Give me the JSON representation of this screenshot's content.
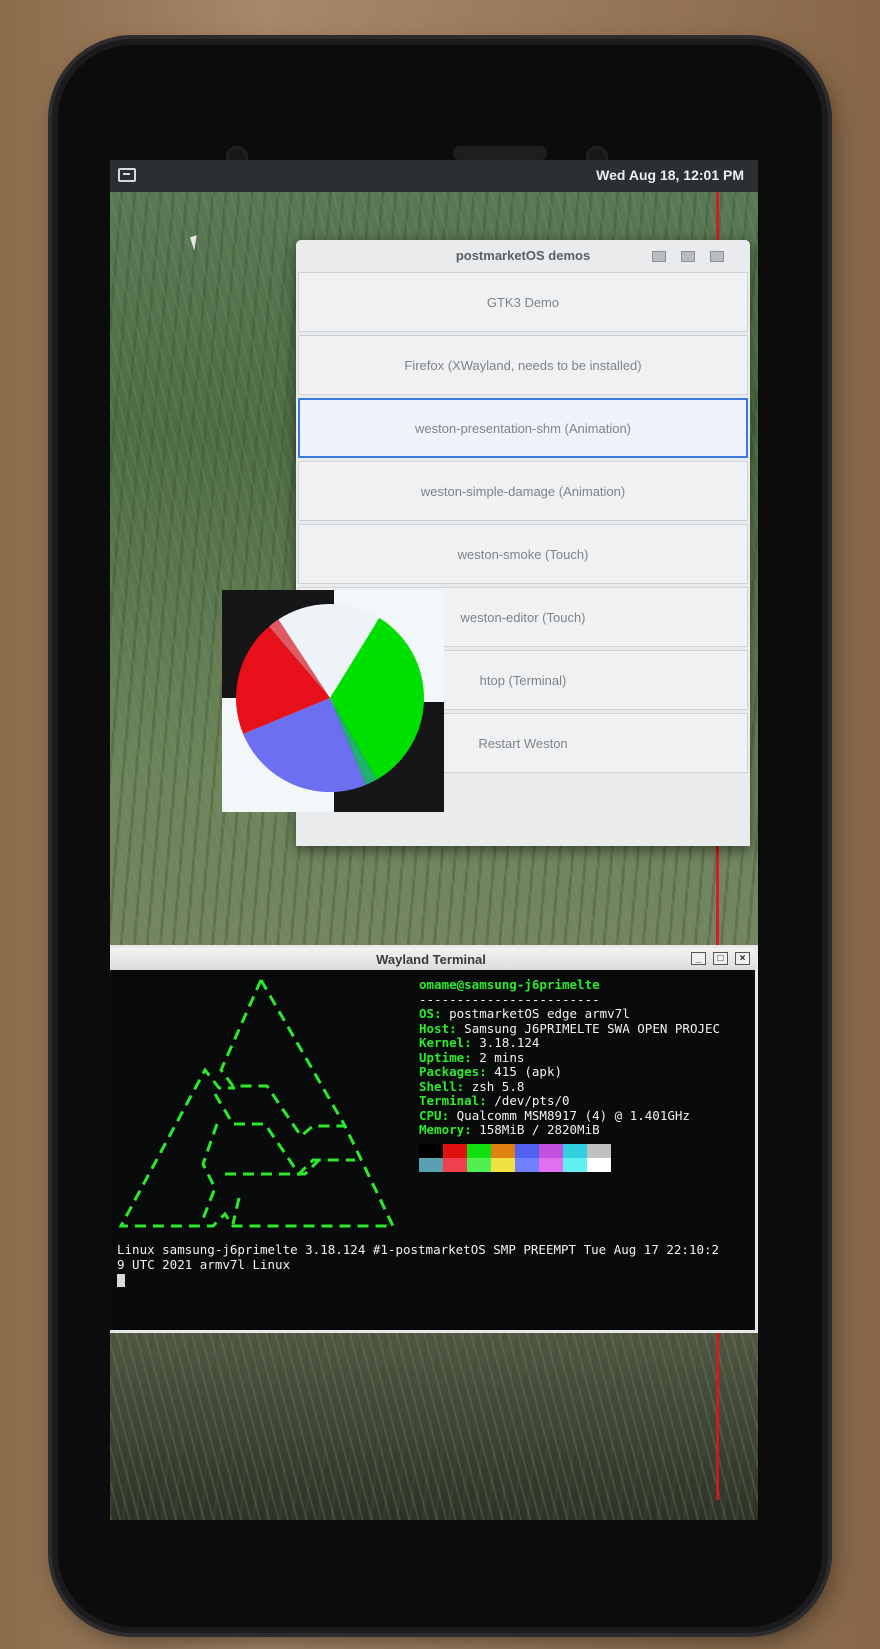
{
  "topbar": {
    "clock": "Wed Aug 18, 12:01 PM",
    "left_icon": "terminal-icon"
  },
  "demos_window": {
    "title": "postmarketOS demos",
    "buttons": [
      {
        "label": "GTK3 Demo"
      },
      {
        "label": "Firefox (XWayland, needs to be installed)"
      },
      {
        "label": "weston-presentation-shm (Animation)",
        "focused": true
      },
      {
        "label": "weston-simple-damage (Animation)"
      },
      {
        "label": "weston-smoke (Touch)"
      },
      {
        "label": "weston-editor (Touch)"
      },
      {
        "label": "htop (Terminal)"
      },
      {
        "label": "Restart Weston"
      }
    ]
  },
  "pie_demo": {
    "slices": [
      {
        "color": "#00e000",
        "value": 0.33
      },
      {
        "color": "#20b070",
        "value": 0.02
      },
      {
        "color": "#6b6ff0",
        "value": 0.25
      },
      {
        "color": "#e8101a",
        "value": 0.2
      },
      {
        "color": "#e05a63",
        "value": 0.02
      },
      {
        "color": "#eef3f8",
        "value": 0.18
      }
    ]
  },
  "terminal": {
    "title": "Wayland Terminal",
    "user": "omame@samsung-j6primelte",
    "separator": "------------------------",
    "fields": [
      {
        "key": "OS",
        "value": "postmarketOS edge armv7l"
      },
      {
        "key": "Host",
        "value": "Samsung J6PRIMELTE SWA OPEN PROJEC"
      },
      {
        "key": "Kernel",
        "value": "3.18.124"
      },
      {
        "key": "Uptime",
        "value": "2 mins"
      },
      {
        "key": "Packages",
        "value": "415 (apk)"
      },
      {
        "key": "Shell",
        "value": "zsh 5.8"
      },
      {
        "key": "Terminal",
        "value": "/dev/pts/0"
      },
      {
        "key": "CPU",
        "value": "Qualcomm MSM8917 (4) @ 1.401GHz"
      },
      {
        "key": "Memory",
        "value": "158MiB / 2820MiB"
      }
    ],
    "palette_top": [
      "#000000",
      "#e01010",
      "#10e010",
      "#e08010",
      "#5060f0",
      "#c050e0",
      "#30d0e0",
      "#c0c0c0"
    ],
    "palette_bottom": [
      "#5aa0b0",
      "#f04050",
      "#50f050",
      "#f0e040",
      "#7080ff",
      "#e070f0",
      "#60f0f0",
      "#ffffff"
    ],
    "uname_line1": "Linux samsung-j6primelte 3.18.124 #1-postmarketOS SMP PREEMPT Tue Aug 17 22:10:2",
    "uname_line2": "9 UTC 2021 armv7l Linux"
  }
}
